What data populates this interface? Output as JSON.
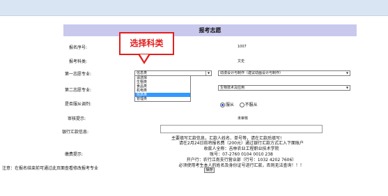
{
  "page_title": "报考志愿",
  "callout_text": "选择科类",
  "fields": {
    "reg_no_label": "报名序号:",
    "reg_no_value": "1007",
    "subject_label": "报考科类:",
    "subject_value": "文史",
    "first_major_label": "第一志愿专业:",
    "first_major_category": "信息类",
    "first_major_value": "动漫设计与制作（建议动画设计与制作）",
    "second_major_label": "第二志愿专业:",
    "second_major_value": "生物技术及应用",
    "obey_label": "是否服从调剂:",
    "obey_yes": "服从",
    "obey_no": "不服从",
    "review_label": "审核提示:",
    "review_value": "未审核",
    "bank_label": "银行汇款信息:",
    "bank_hint": "主要填写汇款信息，汇款人姓名、单号等，请在汇款后填写!",
    "fee_label": "缴费提示:"
  },
  "dropdown_options": [
    "请选择",
    "生物类",
    "食品类",
    "机电类",
    "信息类",
    "管理类"
  ],
  "dropdown_selected_index": 4,
  "fee_lines": [
    "请在2月24日前将报名费（200元）通过银行汇款方式汇入下面账户",
    "收款人全称：吉林农业工程职业技术学院",
    "账号：07-2760 0104 0010 238",
    "开户行：农行江南支行营业部（行号：1032 4202 7606）",
    "必须使用考生本人的姓名及身份证号进行汇款，否则无法查询！！！"
  ],
  "note": "注意：在报名结束前可通过此页面查看修改报考专业",
  "save_button": "保存",
  "colors": {
    "header_bg": "#c9c9ee",
    "callout": "#e02020",
    "top_band": "#d9e5f2",
    "selected": "#3399ff"
  }
}
